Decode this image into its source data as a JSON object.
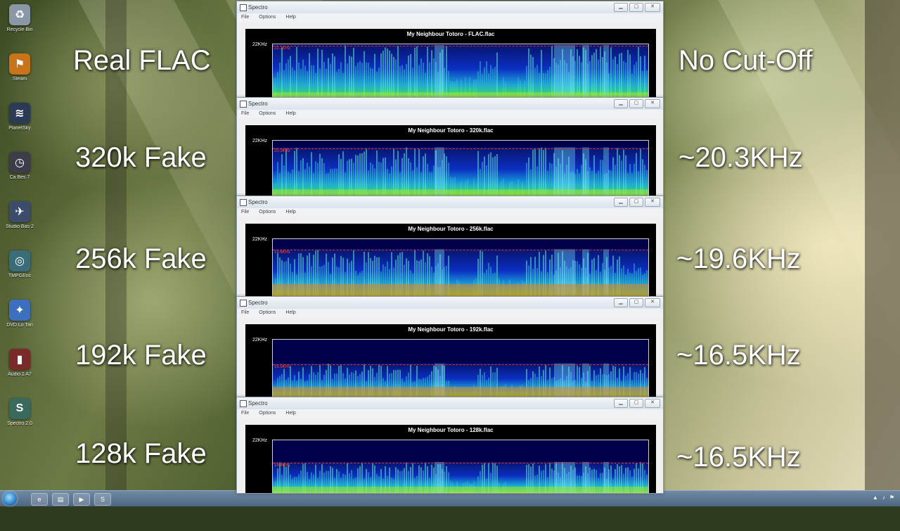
{
  "desktop": {
    "icons": [
      {
        "name": "recycle-bin-icon",
        "label": "Recycle Bin",
        "color": "#8a97a6",
        "glyph": "♻"
      },
      {
        "name": "steam-icon",
        "label": "Steam",
        "color": "#c8741a",
        "glyph": "⚑"
      },
      {
        "name": "planetsky-icon",
        "label": "PlanetSky",
        "color": "#2b3a55",
        "glyph": "≋"
      },
      {
        "name": "game-icon",
        "label": "Ca Bes 7",
        "color": "#3d3d4a",
        "glyph": "◷"
      },
      {
        "name": "studio-icon",
        "label": "Studio Bas 2",
        "color": "#3c4c6a",
        "glyph": "✈"
      },
      {
        "name": "media-icon",
        "label": "TMPGEnc",
        "color": "#3a6c7a",
        "glyph": "◎"
      },
      {
        "name": "bird-icon",
        "label": "DVD Lo Tan",
        "color": "#3d6fbf",
        "glyph": "✦"
      },
      {
        "name": "app-icon",
        "label": "Audio 1 A7",
        "color": "#7a2a2a",
        "glyph": "▮"
      },
      {
        "name": "player-icon",
        "label": "Spectro 2.0",
        "color": "#3a6a5e",
        "glyph": "S"
      }
    ]
  },
  "labels": {
    "left": [
      "Real FLAC",
      "320k Fake",
      "256k Fake",
      "192k Fake",
      "128k Fake"
    ],
    "right": [
      "No Cut-Off",
      "~20.3KHz",
      "~19.6KHz",
      "~16.5KHz",
      "~16.5KHz"
    ]
  },
  "windows": [
    {
      "title": "Spectro",
      "file_title": "My Neighbour Totoro - FLAC.flac",
      "ylabel": "22KHz",
      "cut_label": "22.1KHz",
      "cutoff_khz": 22.05,
      "hot": 0.1
    },
    {
      "title": "Spectro",
      "file_title": "My Neighbour Totoro - 320k.flac",
      "ylabel": "22KHz",
      "cut_label": "20.3KHz",
      "cutoff_khz": 20.3,
      "hot": 0.12
    },
    {
      "title": "Spectro",
      "file_title": "My Neighbour Totoro - 256k.flac",
      "ylabel": "22KHz",
      "cut_label": "19.6KHz",
      "cutoff_khz": 19.6,
      "hot": 0.22
    },
    {
      "title": "Spectro",
      "file_title": "My Neighbour Totoro - 192k.flac",
      "ylabel": "22KHz",
      "cut_label": "16.5KHz",
      "cutoff_khz": 16.5,
      "hot": 0.18
    },
    {
      "title": "Spectro",
      "file_title": "My Neighbour Totoro - 128k.flac",
      "ylabel": "22KHz",
      "cut_label": "16.4KHz",
      "cutoff_khz": 16.5,
      "hot": 0.12
    }
  ],
  "menu": {
    "file": "File",
    "options": "Options",
    "help": "Help"
  },
  "colors": {
    "window_bg": "#dfe6ee",
    "plot_bg": "#00004a",
    "cut_line": "#e0302b"
  }
}
